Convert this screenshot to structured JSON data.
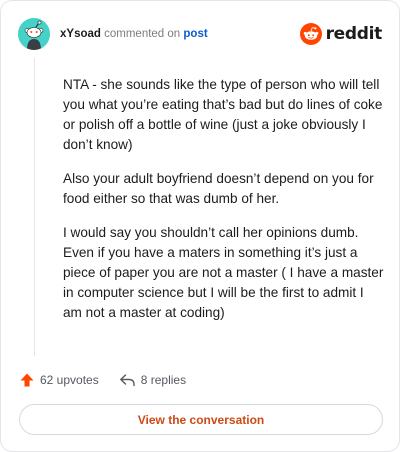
{
  "header": {
    "username": "xYsoad",
    "commented_on_text": "commented on",
    "post_link_text": "post",
    "brand_name": "reddit"
  },
  "comment": {
    "paragraphs": [
      "NTA - she sounds like the type of person who will tell you what you’re eating that’s bad but do lines of coke or polish off a bottle of wine (just a joke obviously I don’t know)",
      "Also your adult boyfriend doesn’t depend on you for food either so that was dumb of her.",
      "I would say you shouldn’t call her opinions dumb. Even if you have a maters in something it’s just a piece of paper you are not a master ( I have a master in computer science but I will be the first to admit I am not a master at coding)"
    ]
  },
  "actions": {
    "upvotes_label": "62 upvotes",
    "replies_label": "8 replies"
  },
  "footer": {
    "view_button_label": "View the conversation"
  },
  "colors": {
    "upvote_orange": "#ff4500",
    "link_blue": "#0b5ccf",
    "button_text": "#cc4a14",
    "avatar_bg": "#46d2c8"
  },
  "icons": {
    "avatar": "snoo-avatar-icon",
    "brand": "reddit-logo-icon",
    "upvote": "upvote-arrow-icon",
    "reply": "reply-arrow-icon"
  }
}
